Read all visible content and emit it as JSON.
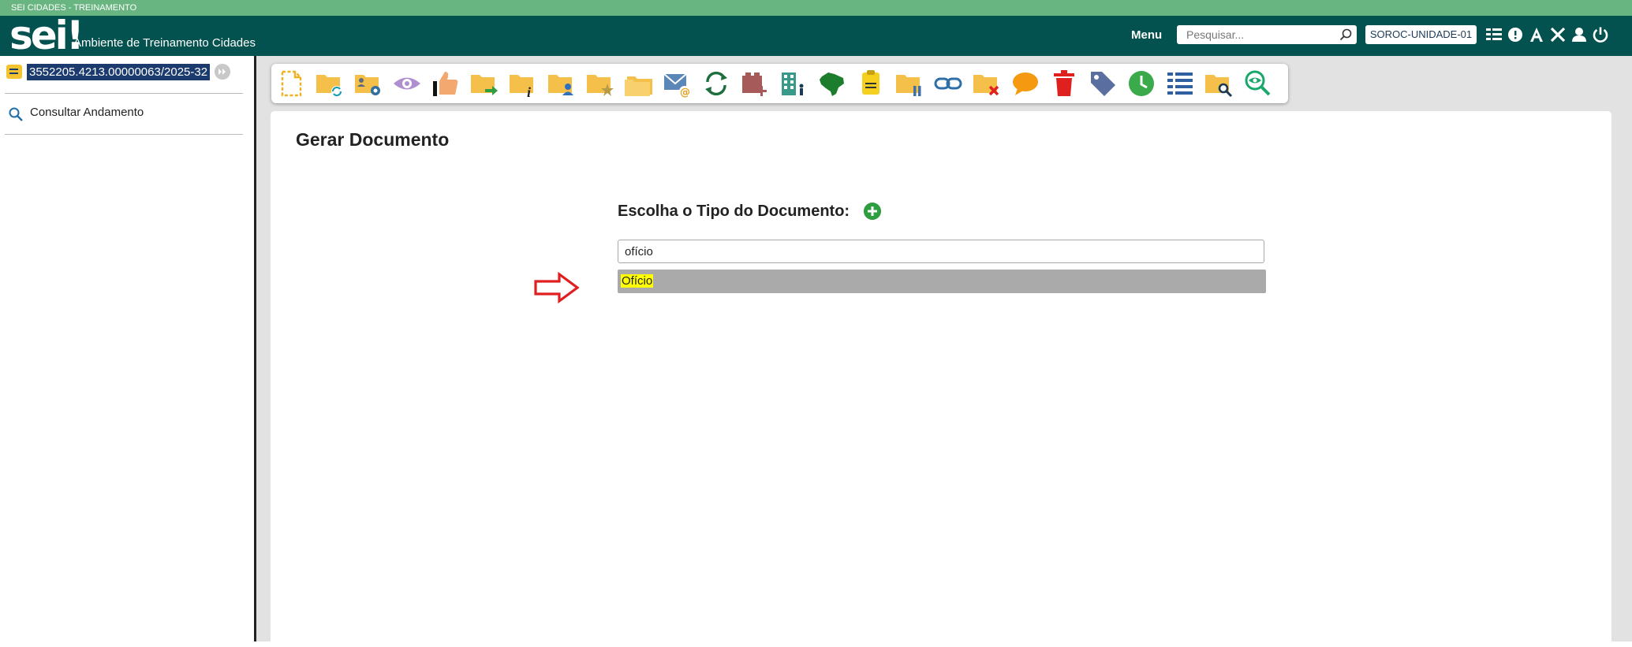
{
  "env_banner": "SEI CIDADES - TREINAMENTO",
  "header": {
    "logo_text": "sei",
    "logo_mark": "!",
    "org_name": "Ambiente de Treinamento Cidades",
    "menu_label": "Menu",
    "search_placeholder": "Pesquisar...",
    "unit_label": "SOROC-UNIDADE-01",
    "icons": [
      "list-view-icon",
      "gear-badge-icon",
      "font-size-icon",
      "tools-icon",
      "user-icon",
      "power-icon"
    ]
  },
  "sidebar": {
    "process_number": "3552205.4213.00000063/2025-32",
    "consultar_label": "Consultar Andamento"
  },
  "toolbar": {
    "icons": [
      "new-document-icon",
      "reopen-process-icon",
      "assign-process-icon",
      "view-icon",
      "thumbs-up-icon",
      "send-process-icon",
      "process-info-icon",
      "assign-user-icon",
      "favorite-folder-icon",
      "folder-icon",
      "send-email-icon",
      "refresh-icon",
      "add-block-icon",
      "building-icon",
      "brazil-map-icon",
      "note-icon",
      "pause-folder-icon",
      "link-icon",
      "remove-folder-icon",
      "comment-icon",
      "delete-icon",
      "tag-icon",
      "clock-icon",
      "list-icon",
      "search-folder-icon",
      "eye-search-icon"
    ]
  },
  "content": {
    "title": "Gerar Documento",
    "choose_label": "Escolha o Tipo do Documento:",
    "type_input_value": "ofício",
    "suggestion": "Ofício"
  },
  "colors": {
    "env_strip": "#69b581",
    "topbar": "#03524f",
    "process_badge": "#1b3a6e",
    "suggestion_bg": "#aaaaaa",
    "highlight": "#ffff00",
    "arrow": "#e02020"
  }
}
